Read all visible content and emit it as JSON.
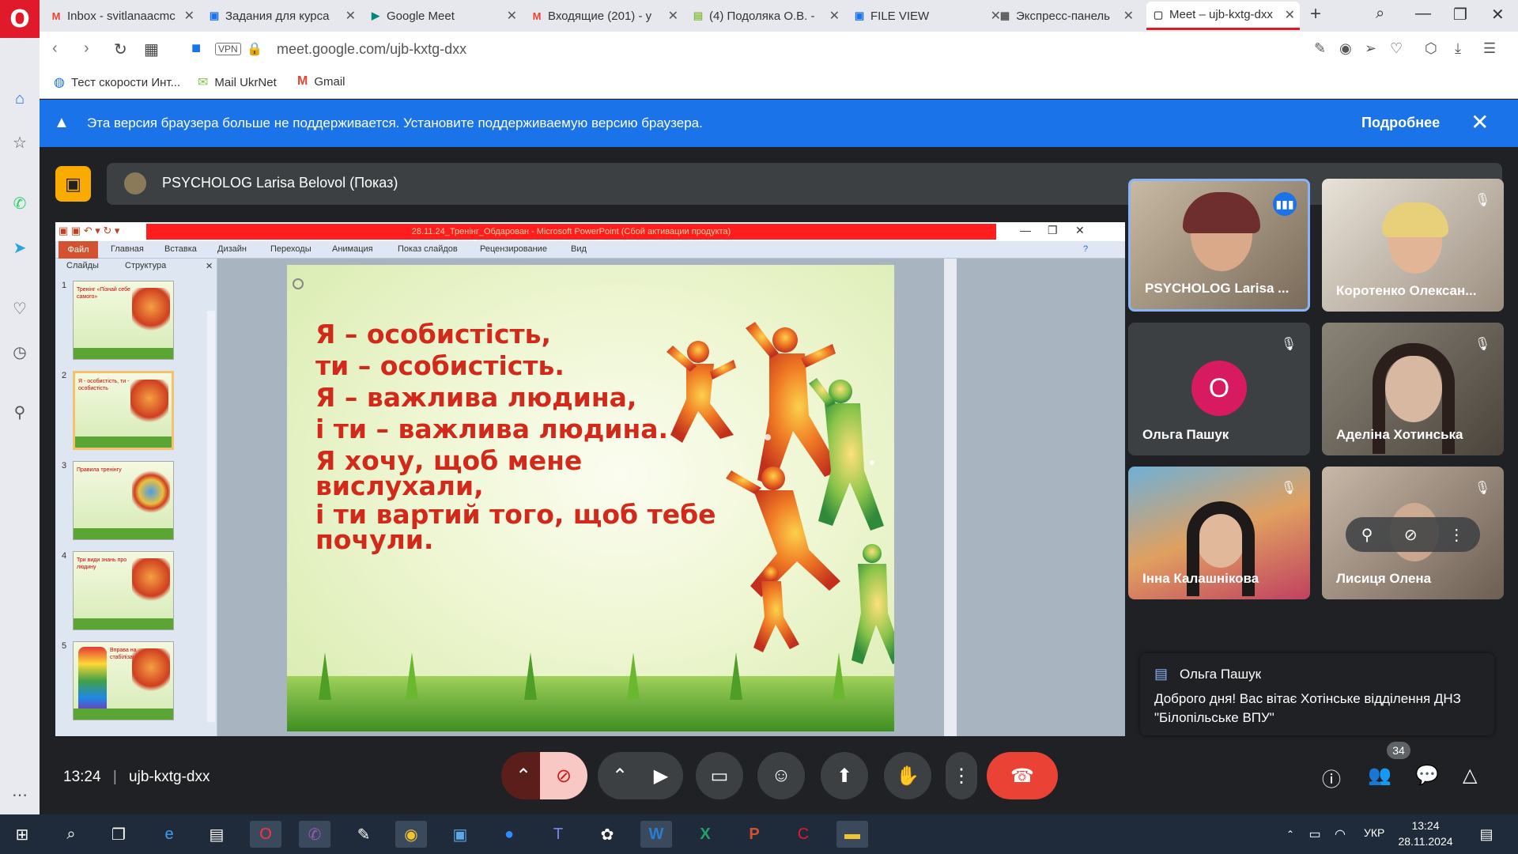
{
  "browser": {
    "tabs": [
      {
        "label": "Inbox - svitlanaacmc",
        "fav": "M",
        "favColor": "#ea4335"
      },
      {
        "label": "Задания для курса",
        "fav": "▣",
        "favColor": "#1a73e8"
      },
      {
        "label": "Google Meet",
        "fav": "▶",
        "favColor": "#00897b"
      },
      {
        "label": "Входящие (201) - y",
        "fav": "M",
        "favColor": "#ea4335"
      },
      {
        "label": "(4) Подоляка О.В. -",
        "fav": "▤",
        "favColor": "#8bc34a"
      },
      {
        "label": "FILE VIEW",
        "fav": "▣",
        "favColor": "#1a73e8"
      },
      {
        "label": "Экспресс-панель",
        "fav": "▦",
        "favColor": "#555555"
      },
      {
        "label": "Meet – ujb-kxtg-dxx",
        "fav": "▢",
        "favColor": "#555555"
      }
    ],
    "url": "meet.google.com/ujb-kxtg-dxx",
    "vpn": "VPN",
    "bookmarks": [
      {
        "label": "Тест скорости Инт...",
        "icon": "◍"
      },
      {
        "label": "Mail UkrNet",
        "icon": "✉"
      },
      {
        "label": "Gmail",
        "icon": "M"
      }
    ],
    "banner": {
      "text": "Эта версия браузера больше не поддерживается. Установите поддерживаемую версию браузера.",
      "more": "Подробнее"
    }
  },
  "meet": {
    "presenter_label": "PSYCHOLOG Larisa Belovol (Показ)",
    "meeting_time": "13:24",
    "meeting_code": "ujb-kxtg-dxx",
    "people_count": "34",
    "participants": [
      {
        "name": "PSYCHOLOG Larisa ...",
        "speaking": true
      },
      {
        "name": "Коротенко Олексан...",
        "speaking": false
      },
      {
        "name": "Ольга Пашук",
        "speaking": false,
        "initial": "О"
      },
      {
        "name": "Аделіна Хотинська",
        "speaking": false
      },
      {
        "name": "Інна Калашнікова",
        "speaking": false
      },
      {
        "name": "Лисиця Олена",
        "speaking": false
      }
    ],
    "chat": {
      "sender": "Ольга Пашук",
      "message": "Доброго дня! Вас вітає Хотінське відділення ДНЗ \"Білопільське ВПУ\""
    }
  },
  "ppt": {
    "title": "28.11.24_Тренінг_Обдарован - Microsoft PowerPoint (Сбой активации продукта)",
    "ribbon_tabs": [
      "Файл",
      "Главная",
      "Вставка",
      "Дизайн",
      "Переходы",
      "Анимация",
      "Показ слайдов",
      "Рецензирование",
      "Вид"
    ],
    "panel_tabs": [
      "Слайды",
      "Структура"
    ],
    "thumbnails": [
      {
        "num": "1",
        "text": "Тренінг «Пізнай себе самого»"
      },
      {
        "num": "2",
        "text": "Я - особистість, ти - особистість"
      },
      {
        "num": "3",
        "text": "Правила тренінгу"
      },
      {
        "num": "4",
        "text": "Три види знань про людину"
      },
      {
        "num": "5",
        "text": "Вправа на стабілізацію"
      }
    ],
    "slide_lines": [
      "Я – особистість,",
      "ти – особистість.",
      "Я – важлива людина,",
      "і ти – важлива людина.",
      "Я хочу, щоб мене",
      "вислухали,",
      "і ти вартий того, щоб тебе",
      "почули."
    ]
  },
  "taskbar": {
    "lang": "УКР",
    "time": "13:24",
    "date": "28.11.2024"
  },
  "colors": {
    "accent": "#1a73e8",
    "danger": "#ea4335",
    "slideText": "#d22a1a"
  }
}
